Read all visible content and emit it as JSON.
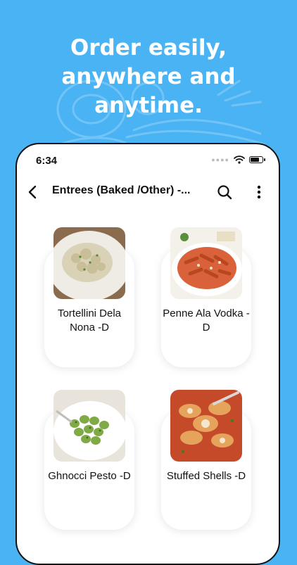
{
  "promo": {
    "headline_line1": "Order easily,",
    "headline_line2": "anywhere and",
    "headline_line3": "anytime."
  },
  "status_bar": {
    "time": "6:34",
    "battery_level": 0.85,
    "icons": [
      "cellular-dots-icon",
      "wifi-icon",
      "battery-icon"
    ]
  },
  "app_bar": {
    "title": "Entrees (Baked /Other) -...",
    "icons": [
      "chevron-left-icon",
      "search-icon",
      "more-vertical-icon"
    ]
  },
  "menu_items": [
    {
      "label": "Tortellini Dela Nona -D",
      "image": "tortellini-photo"
    },
    {
      "label": "Penne Ala Vodka -D",
      "image": "penne-photo"
    },
    {
      "label": "Ghnocci Pesto -D",
      "image": "gnocchi-photo"
    },
    {
      "label": "Stuffed Shells -D",
      "image": "shells-photo"
    }
  ],
  "colors": {
    "background": "#4ab3f4",
    "text": "#111111",
    "card": "#ffffff"
  }
}
